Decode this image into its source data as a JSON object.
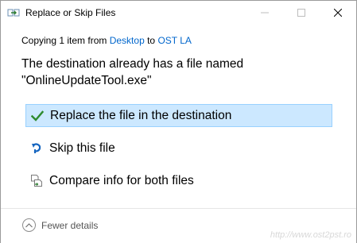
{
  "window": {
    "title": "Replace or Skip Files"
  },
  "copying": {
    "prefix": "Copying 1 item from ",
    "source": "Desktop",
    "middle": " to ",
    "destination": "OST LA"
  },
  "message": {
    "line1": "The destination already has a file named",
    "line2": "\"OnlineUpdateTool.exe\""
  },
  "options": [
    {
      "label": "Replace the file in the destination",
      "icon": "checkmark-icon",
      "selected": true
    },
    {
      "label": "Skip this file",
      "icon": "skip-arrow-icon",
      "selected": false
    },
    {
      "label": "Compare info for both files",
      "icon": "compare-files-icon",
      "selected": false
    }
  ],
  "footer": {
    "fewer_details": "Fewer details",
    "watermark": "http://www.ost2pst.ro"
  },
  "colors": {
    "link": "#0066cc",
    "selected_bg": "#cce8ff",
    "selected_border": "#99d1ff",
    "check_green": "#2e8b2e",
    "skip_blue": "#1565c0"
  }
}
